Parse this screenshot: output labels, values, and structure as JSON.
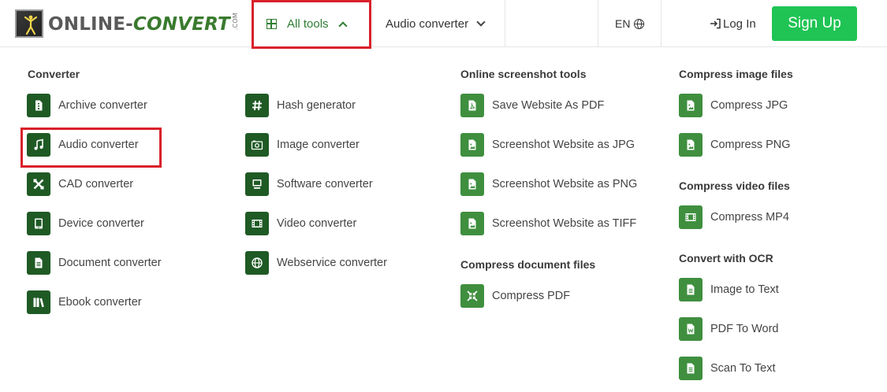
{
  "header": {
    "logo": {
      "brand_part1": "ONLINE-",
      "brand_part2": "CONVERT",
      "brand_suffix": ".COM"
    },
    "all_tools_label": "All tools",
    "audio_converter_label": "Audio converter",
    "language_label": "EN",
    "login_label": "Log In",
    "signup_label": "Sign Up"
  },
  "colors": {
    "accent_green": "#2e7d32",
    "dark_icon_green": "#1f5a25",
    "icon_green": "#3f8f3f",
    "signup_green": "#1fc454",
    "highlight_red": "#d9212b"
  },
  "menu": {
    "converter": {
      "title": "Converter",
      "items": [
        {
          "label": "Archive converter",
          "icon": "archive-file-icon"
        },
        {
          "label": "Audio converter",
          "icon": "music-note-icon"
        },
        {
          "label": "CAD converter",
          "icon": "cad-tools-icon"
        },
        {
          "label": "Device converter",
          "icon": "tablet-device-icon"
        },
        {
          "label": "Document converter",
          "icon": "document-icon"
        },
        {
          "label": "Ebook converter",
          "icon": "books-icon"
        }
      ]
    },
    "converter2": {
      "items": [
        {
          "label": "Hash generator",
          "icon": "hash-icon"
        },
        {
          "label": "Image converter",
          "icon": "camera-icon"
        },
        {
          "label": "Software converter",
          "icon": "monitor-icon"
        },
        {
          "label": "Video converter",
          "icon": "film-icon"
        },
        {
          "label": "Webservice converter",
          "icon": "globe-icon"
        }
      ]
    },
    "screenshot": {
      "title": "Online screenshot tools",
      "items": [
        {
          "label": "Save Website As PDF",
          "icon": "pdf-file-icon"
        },
        {
          "label": "Screenshot Website as JPG",
          "icon": "image-file-icon"
        },
        {
          "label": "Screenshot Website as PNG",
          "icon": "image-file-icon"
        },
        {
          "label": "Screenshot Website as TIFF",
          "icon": "image-file-icon"
        }
      ]
    },
    "compress_doc": {
      "title": "Compress document files",
      "items": [
        {
          "label": "Compress PDF",
          "icon": "compress-arrows-icon"
        }
      ]
    },
    "compress_image": {
      "title": "Compress image files",
      "items": [
        {
          "label": "Compress JPG",
          "icon": "image-file-icon"
        },
        {
          "label": "Compress PNG",
          "icon": "image-file-icon"
        }
      ]
    },
    "compress_video": {
      "title": "Compress video files",
      "items": [
        {
          "label": "Compress MP4",
          "icon": "film-icon"
        }
      ]
    },
    "ocr": {
      "title": "Convert with OCR",
      "items": [
        {
          "label": "Image to Text",
          "icon": "text-file-icon"
        },
        {
          "label": "PDF To Word",
          "icon": "word-file-icon"
        },
        {
          "label": "Scan To Text",
          "icon": "text-file-icon"
        }
      ]
    }
  }
}
